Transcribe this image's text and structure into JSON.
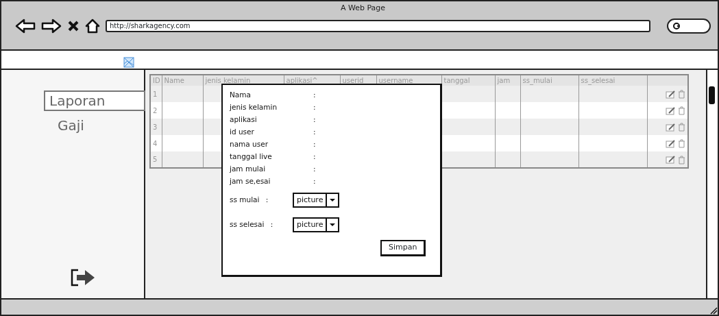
{
  "window": {
    "title": "A Web Page"
  },
  "browser": {
    "url": "http://sharkagency.com"
  },
  "sidebar": {
    "items": [
      {
        "label": "Laporan",
        "selected": true
      },
      {
        "label": "Gaji",
        "selected": false
      }
    ]
  },
  "table": {
    "columns": [
      "ID",
      "Name",
      "jenis kelamin",
      "aplikasi^",
      "userid",
      "username",
      "tanggal",
      "jam",
      "ss_mulai",
      "ss_selesai"
    ],
    "rows": [
      {
        "id": "1"
      },
      {
        "id": "2"
      },
      {
        "id": "3"
      },
      {
        "id": "4"
      },
      {
        "id": "5"
      }
    ]
  },
  "dialog": {
    "fields": [
      {
        "kind": "text",
        "label": "Nama",
        "separator": ":"
      },
      {
        "kind": "text",
        "label": "jenis kelamin",
        "separator": ":"
      },
      {
        "kind": "text",
        "label": "aplikasi",
        "separator": ":"
      },
      {
        "kind": "text",
        "label": "id user",
        "separator": ":"
      },
      {
        "kind": "text",
        "label": "nama user",
        "separator": ":"
      },
      {
        "kind": "text",
        "label": "tanggal live",
        "separator": ":"
      },
      {
        "kind": "text",
        "label": "jam mulai",
        "separator": ":"
      },
      {
        "kind": "text",
        "label": "jam se,esai",
        "separator": ":"
      },
      {
        "kind": "select",
        "label": "ss mulai",
        "separator": ":",
        "value": "picture"
      },
      {
        "kind": "select",
        "label": "ss selesai",
        "separator": ":",
        "value": "picture"
      }
    ],
    "button": "Simpan"
  }
}
